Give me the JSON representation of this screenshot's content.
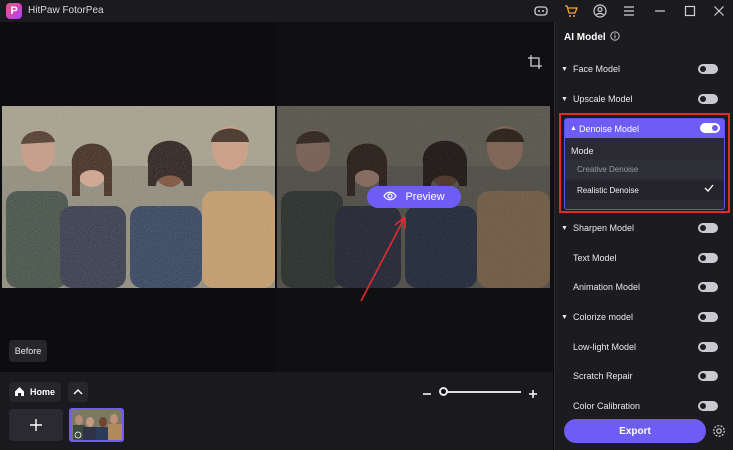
{
  "app": {
    "title": "HitPaw FotorPea",
    "logo_letter": "P"
  },
  "titlebar_icons": [
    "discord-icon",
    "cart-icon",
    "user-icon",
    "menu-icon",
    "minimize-icon",
    "maximize-icon",
    "close-icon"
  ],
  "canvas": {
    "preview_label": "Preview",
    "before_label": "Before"
  },
  "bottom": {
    "home_label": "Home",
    "zoom_level": 0
  },
  "panel": {
    "title": "AI Model",
    "models": [
      {
        "label": "Face Model",
        "expandable": true,
        "enabled": false
      },
      {
        "label": "Upscale Model",
        "expandable": true,
        "enabled": false
      },
      {
        "label": "Sharpen Model",
        "expandable": true,
        "enabled": false
      },
      {
        "label": "Text Model",
        "expandable": false,
        "enabled": false
      },
      {
        "label": "Animation Model",
        "expandable": false,
        "enabled": false
      },
      {
        "label": "Colorize model",
        "expandable": true,
        "enabled": false
      },
      {
        "label": "Low-light Model",
        "expandable": false,
        "enabled": false
      },
      {
        "label": "Scratch Repair",
        "expandable": false,
        "enabled": false
      },
      {
        "label": "Color Calibration",
        "expandable": false,
        "enabled": false
      }
    ],
    "denoise": {
      "label": "Denoise Model",
      "enabled": true,
      "mode_label": "Mode",
      "options": [
        "Creative Denoise",
        "Realistic Denoise"
      ],
      "selected": "Realistic Denoise"
    },
    "export_label": "Export"
  },
  "colors": {
    "accent": "#6d5df5",
    "highlight_border": "#e5292f",
    "panel_bg": "#1c1c20"
  }
}
